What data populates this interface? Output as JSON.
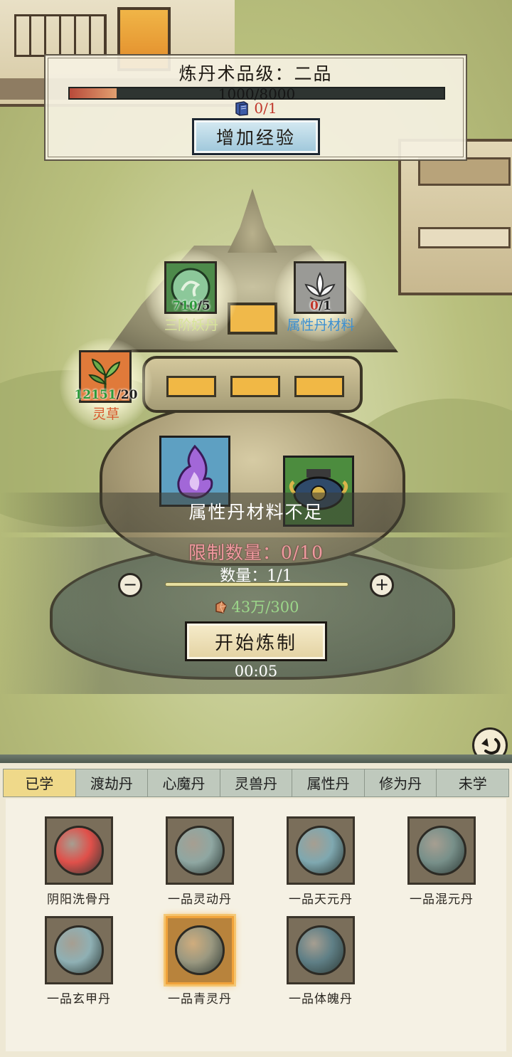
{
  "header": {
    "title": "炼丹术品级：二品",
    "exp_text": "1000/8000",
    "exp_progress": 0.125,
    "book_count": "0/1",
    "add_exp_label": "增加经验"
  },
  "materials": [
    {
      "name": "三阶妖丹",
      "have": "710",
      "need": "/5",
      "name_color": "#d7e49a"
    },
    {
      "name": "属性丹材料",
      "have": "0",
      "need": "/1",
      "name_color": "#3c8fd0",
      "have_color": "#c0362b"
    },
    {
      "name": "灵草",
      "have": "12151",
      "need": "/20",
      "name_color": "#d9572b"
    }
  ],
  "status_message": "属性丹材料不足",
  "controls": {
    "limit_text": "限制数量：0/10",
    "quantity_text": "数量：1/1",
    "minus_label": "−",
    "plus_label": "+",
    "cost_text": "43万/300",
    "start_label": "开始炼制",
    "timer": "00:05"
  },
  "tabs": [
    {
      "label": "已学",
      "active": true
    },
    {
      "label": "渡劫丹"
    },
    {
      "label": "心魔丹"
    },
    {
      "label": "灵兽丹"
    },
    {
      "label": "属性丹"
    },
    {
      "label": "修为丹"
    },
    {
      "label": "未学"
    }
  ],
  "recipes": [
    {
      "label": "阴阳洗骨丹",
      "color": "#e0504a"
    },
    {
      "label": "一品灵动丹",
      "color": "#8fa7a2"
    },
    {
      "label": "一品天元丹",
      "color": "#7fa8b0"
    },
    {
      "label": "一品混元丹",
      "color": "#78908a"
    },
    {
      "label": "一品玄甲丹",
      "color": "#8fb0b4"
    },
    {
      "label": "一品青灵丹",
      "color": "#9a9880",
      "selected": true
    },
    {
      "label": "一品体魄丹",
      "color": "#5f7f86"
    }
  ]
}
